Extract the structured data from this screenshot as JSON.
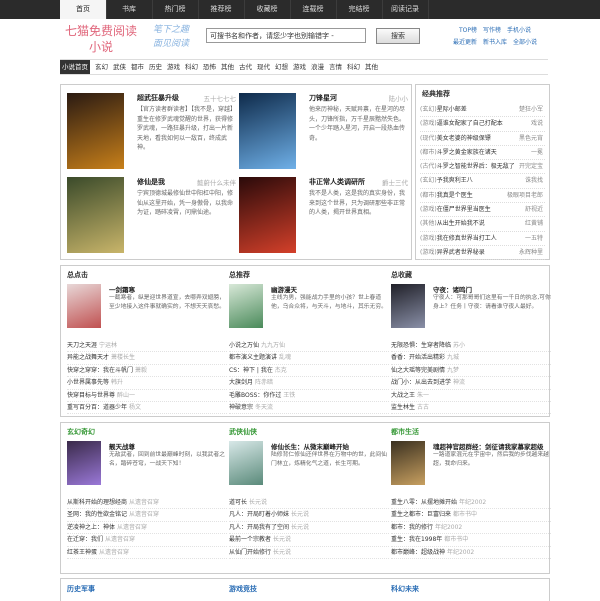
{
  "topnav": [
    "首页",
    "书库",
    "热门榜",
    "推荐榜",
    "收藏榜",
    "连载榜",
    "完结榜",
    "阅读记录"
  ],
  "logo": {
    "line1": "七猫免费阅读",
    "line2": "小说",
    "slogan1": "笔下之趣",
    "slogan2": "面见阅读"
  },
  "search": {
    "placeholder": "可搜书名和作者，请您少字也别输错字 -",
    "button": "搜索"
  },
  "toplinks": [
    "TOP榜",
    "写作榜",
    "手机小说",
    "最近更新",
    "新书入库",
    "全部小说"
  ],
  "categories": [
    "小说首页",
    "玄幻",
    "武侠",
    "都市",
    "历史",
    "游戏",
    "科幻",
    "恐怖",
    "其他",
    "古代",
    "现代",
    "幻想",
    "游戏",
    "浪漫",
    "言情",
    "科幻",
    "其他"
  ],
  "featured": [
    {
      "title": "超武狂暴升级",
      "author": "五十七七七",
      "desc": "【官方读者群读者】【我不是，穿越】重生在修罗武魂觉醒的世界，获得修罗武魂，一路狂暴升级，打出一片新天地，看我如何以一敌百，终成武神。",
      "cover": [
        "#2a1a12",
        "#c8801a"
      ]
    },
    {
      "title": "刀锋星河",
      "author": "陆小小",
      "desc": "他来历神秘，天赋异禀，在星河的尽头，刀锋所指，万千星辰黯然失色。一个少年踏入星河，开启一段热血传奇。",
      "cover": [
        "#0e2a4a",
        "#6fb0e8"
      ]
    },
    {
      "title": "修仙是我",
      "author": "懿蔚什么未伴",
      "desc": "宁宾顶德城最修仙世中阳杠中阳，修仙从这里开始，凭一身傲骨，以我命为证，踏碎凌霄，问鼎仙途。",
      "cover": [
        "#3a4a2a",
        "#c9b56a"
      ]
    },
    {
      "title": "非正常人类调研所",
      "author": "爵士三代",
      "desc": "我不是人类，这是我的真实身份，我来到这个世界，只为调研那些非正常的人类，揭开世界真相。",
      "cover": [
        "#2a0a0a",
        "#d4402a"
      ]
    }
  ],
  "classic": {
    "title": "经典推荐",
    "items": [
      {
        "cat": "(玄幻)",
        "name": "星际小邮差",
        "author": "楚狂小军"
      },
      {
        "cat": "(游戏)",
        "name": "逼谁女配家了自己打配本",
        "author": "戏说"
      },
      {
        "cat": "(现代)",
        "name": "美女老婆的神级保镖",
        "author": "黑色元宵"
      },
      {
        "cat": "(都市)",
        "name": "斗罗之黄金家族在诸天",
        "author": "一冕"
      },
      {
        "cat": "(古代)",
        "name": "斗罗之智能世界后：极无敌了",
        "author": "开完定宝"
      },
      {
        "cat": "(玄幻)",
        "name": "予我爽利王八",
        "author": "诛我找"
      },
      {
        "cat": "(都市)",
        "name": "我真是个医生",
        "author": "极眼项目老郎"
      },
      {
        "cat": "(游戏)",
        "name": "在僵尸世界里当医生",
        "author": "舒视近"
      },
      {
        "cat": "(其他)",
        "name": "从出生开始我不说",
        "author": "红黄铺"
      },
      {
        "cat": "(游戏)",
        "name": "我在修真世界当打工人",
        "author": "一五特"
      },
      {
        "cat": "(游戏)",
        "name": "异界武者世界秘录",
        "author": "永辉种里"
      }
    ]
  },
  "sections": [
    {
      "title": "总点击",
      "book": {
        "title": "一剑霜寒",
        "desc": "一截寒者，纵是迎世界道宣，去哪弄双翅膀，至少地接入这件事就确实的，不想天天哀愁。",
        "cover": [
          "#e8d8d8",
          "#c05050"
        ]
      },
      "list": [
        [
          "天刀之天涯",
          "宁运林"
        ],
        [
          "异能之战舞天才",
          "萧楼长生"
        ],
        [
          "快穿之穿穿：我在斗帆门",
          "萧毅"
        ],
        [
          "小世界属事先等",
          "韩升"
        ],
        [
          "快穿目标与世界尊",
          "醉山一"
        ],
        [
          "重写百分百：道器少年",
          "杨文"
        ]
      ]
    },
    {
      "title": "总推荐",
      "book": {
        "title": "幽游漫天",
        "desc": "主线为男，强能战力手里的小孩？世上春道他，乌合众将，与天斗，与地斗，其乐无穷。",
        "cover": [
          "#d8e8d8",
          "#4a8a5a"
        ]
      },
      "list": [
        [
          "小说之万仙",
          "九九万仙"
        ],
        [
          "都市演义主题演讲",
          "乱魂"
        ],
        [
          "CS：神下 | 我在",
          "杰克"
        ],
        [
          "大旗剑月",
          "阵赤暗"
        ],
        [
          "毛雕BOSS：你作过",
          "王铁"
        ],
        [
          "神破意宗",
          "冬天流"
        ]
      ]
    },
    {
      "title": "总收藏",
      "book": {
        "title": "守夜：诸鸣门",
        "desc": "守夜人：可那哥哥们这里有一千日的执念,可你身上？任务丨守夜：请看谁守夜人最好。",
        "cover": [
          "#202028",
          "#8a90a8"
        ]
      },
      "list": [
        [
          "无限恐惧：生穿者降临",
          "苏小"
        ],
        [
          "香香：开始活出精彩",
          "九城"
        ],
        [
          "仙之大瑶等完美剧情",
          "九梦"
        ],
        [
          "战门小：从出去到进学",
          "神流"
        ],
        [
          "大战之王",
          "朱一"
        ],
        [
          "监生林生",
          "古古"
        ]
      ]
    }
  ],
  "sections2": [
    {
      "title": "玄幻奇幻",
      "book": {
        "title": "靓天战尊",
        "desc": "无敌武者，回到前世最巅峰时刻，以我武者之名，踏碎苍穹，一战天下知！",
        "cover": [
          "#3a2a4a",
          "#9a78d8"
        ]
      },
      "list": [
        [
          "从斯科开始的理想经商",
          "从遗音召穿"
        ],
        [
          "圣网：我的性欲金铭记",
          "从遗音召穿"
        ],
        [
          "逆凌神之上：神体",
          "从遗音召穿"
        ],
        [
          "在迁穿：我们",
          "从遗音召穿"
        ],
        [
          "红茶王神蛋",
          "从遗音召穿"
        ]
      ]
    },
    {
      "title": "武侠仙侠",
      "book": {
        "title": "修仙长生：从微末巅峰开始",
        "desc": "陆修背仁修仙还伴世界在万物中的世，此间仙门林立，炼精化气之道，长生可期。",
        "cover": [
          "#d8e8e8",
          "#5a8a7a"
        ]
      },
      "list": [
        [
          "道可长",
          "长元说"
        ],
        [
          "凡人：开局盯着小师妹",
          "长元说"
        ],
        [
          "凡人：开局我有了空间",
          "长元说"
        ],
        [
          "最前一个宗教者",
          "长元说"
        ],
        [
          "从仙门开始修行",
          "长元说"
        ]
      ]
    },
    {
      "title": "都市生活",
      "book": {
        "title": "魂超神官超群经：剑征请我家慕家超级",
        "desc": "一路道家混元在宇宙中，然后我的步伐越来越超，我命归来。",
        "cover": [
          "#3a3020",
          "#c8a060"
        ]
      },
      "list": [
        [
          "重生八零：从摆地摊开始",
          "年纪2002"
        ],
        [
          "重生之都市：巨富归来",
          "都市书中"
        ],
        [
          "都市：我的修行",
          "年纪2002"
        ],
        [
          "重生：我在1998年",
          "都市书中"
        ],
        [
          "都市巅峰：超级战神",
          "年纪2002"
        ]
      ]
    }
  ],
  "bottom": [
    "历史军事",
    "游戏竞技",
    "科幻未来"
  ]
}
